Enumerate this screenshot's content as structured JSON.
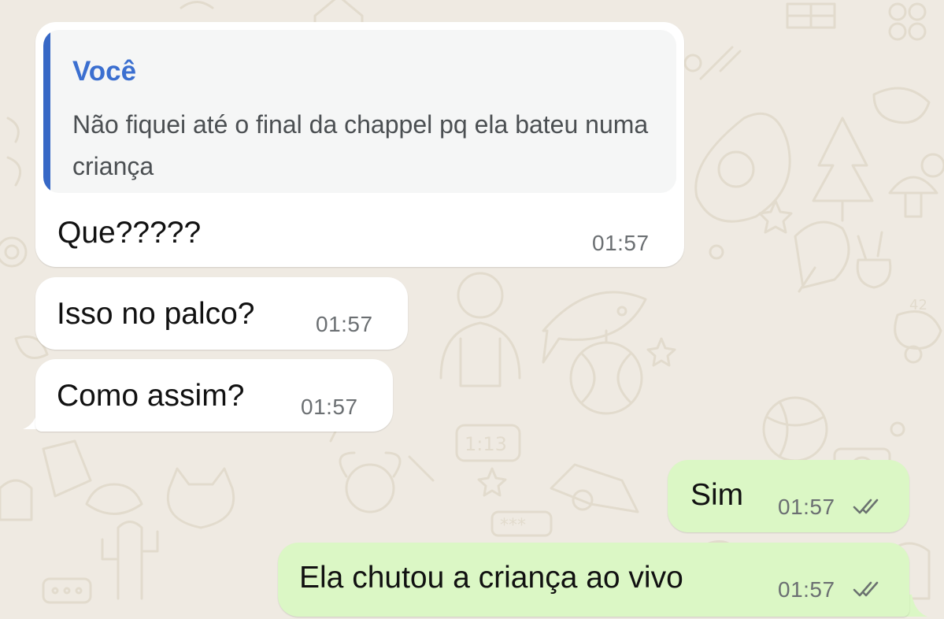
{
  "chat": {
    "messages": [
      {
        "direction": "incoming",
        "reply_to": {
          "author": "Você",
          "text": "Não fiquei até o final da chappel pq ela bateu numa criança"
        },
        "text": "Que?????",
        "time": "01:57"
      },
      {
        "direction": "incoming",
        "text": "Isso no palco?",
        "time": "01:57"
      },
      {
        "direction": "incoming",
        "text": "Como assim?",
        "time": "01:57"
      },
      {
        "direction": "outgoing",
        "text": "Sim",
        "time": "01:57",
        "status_icon": "double-check-icon"
      },
      {
        "direction": "outgoing",
        "text": "Ela chutou a criança ao vivo",
        "time": "01:57",
        "status_icon": "double-check-icon"
      }
    ]
  },
  "colors": {
    "background": "#efeae2",
    "incoming_bubble": "#ffffff",
    "outgoing_bubble": "#dbf7c5",
    "quote_accent": "#3768c6",
    "quote_author": "#3b6fd0",
    "doodle": "#e3dccf"
  }
}
